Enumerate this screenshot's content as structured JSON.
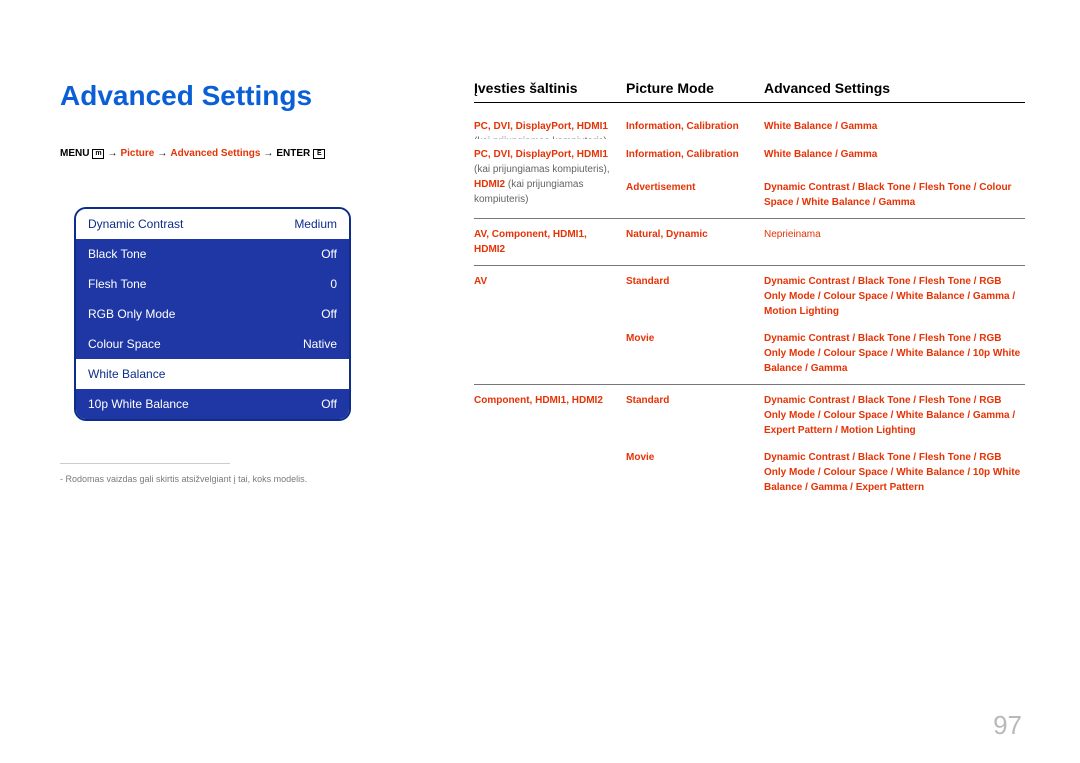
{
  "left": {
    "heading": "Advanced Settings",
    "breadcrumb": {
      "menu": "MENU",
      "icon1": "m",
      "arrow": "→",
      "picture": "Picture",
      "adv": "Advanced Settings",
      "enter": "ENTER",
      "icon2": "E"
    },
    "menu": [
      {
        "label": "Dynamic Contrast",
        "value": "Medium",
        "style": "white"
      },
      {
        "label": "Black Tone",
        "value": "Off",
        "style": "blue"
      },
      {
        "label": "Flesh Tone",
        "value": "0",
        "style": "blue"
      },
      {
        "label": "RGB Only Mode",
        "value": "Off",
        "style": "blue"
      },
      {
        "label": "Colour Space",
        "value": "Native",
        "style": "blue"
      },
      {
        "label": "White Balance",
        "value": "",
        "style": "white"
      },
      {
        "label": "10p White Balance",
        "value": "Off",
        "style": "blue"
      }
    ],
    "footnote": "Rodomas vaizdas gali skirtis atsižvelgiant į tai, koks modelis."
  },
  "table": {
    "headers": {
      "c1": "Įvesties šaltinis",
      "c2": "Picture Mode",
      "c3": "Advanced Settings"
    },
    "rows": {
      "r0": {
        "c1_main": "PC, DVI, DisplayPort, HDMI1",
        "c1_sub1": "(kai prijungiamas kompiuteris),",
        "c1_hdmi2": "HDMI2",
        "c1_sub2": " (kai prijungiamas kompiuteris)",
        "m0": {
          "c2": "Information, Calibration",
          "c3": "White Balance / Gamma"
        },
        "m1": {
          "c2": "Advertisement",
          "c3": "Dynamic Contrast / Black Tone / Flesh Tone / Colour Space / White Balance / Gamma"
        }
      },
      "r1": {
        "c1": "AV, Component, HDMI1, HDMI2",
        "c2": "Natural, Dynamic",
        "c3": "Neprieinama"
      },
      "r2": {
        "c1": "AV",
        "m0": {
          "c2": "Standard",
          "c3": "Dynamic Contrast / Black Tone / Flesh Tone / RGB Only Mode / Colour Space / White Balance / Gamma / Motion Lighting"
        },
        "m1": {
          "c2": "Movie",
          "c3": "Dynamic Contrast / Black Tone / Flesh Tone / RGB Only Mode / Colour Space / White Balance / 10p White Balance / Gamma"
        }
      },
      "r3": {
        "c1": "Component, HDMI1, HDMI2",
        "m0": {
          "c2": "Standard",
          "c3": "Dynamic Contrast / Black Tone / Flesh Tone / RGB Only Mode / Colour Space / White Balance / Gamma / Expert Pattern / Motion Lighting"
        },
        "m1": {
          "c2": "Movie",
          "c3": "Dynamic Contrast / Black Tone / Flesh Tone / RGB Only Mode / Colour Space / White Balance / 10p White Balance / Gamma / Expert Pattern"
        }
      }
    }
  },
  "page_number": "97"
}
